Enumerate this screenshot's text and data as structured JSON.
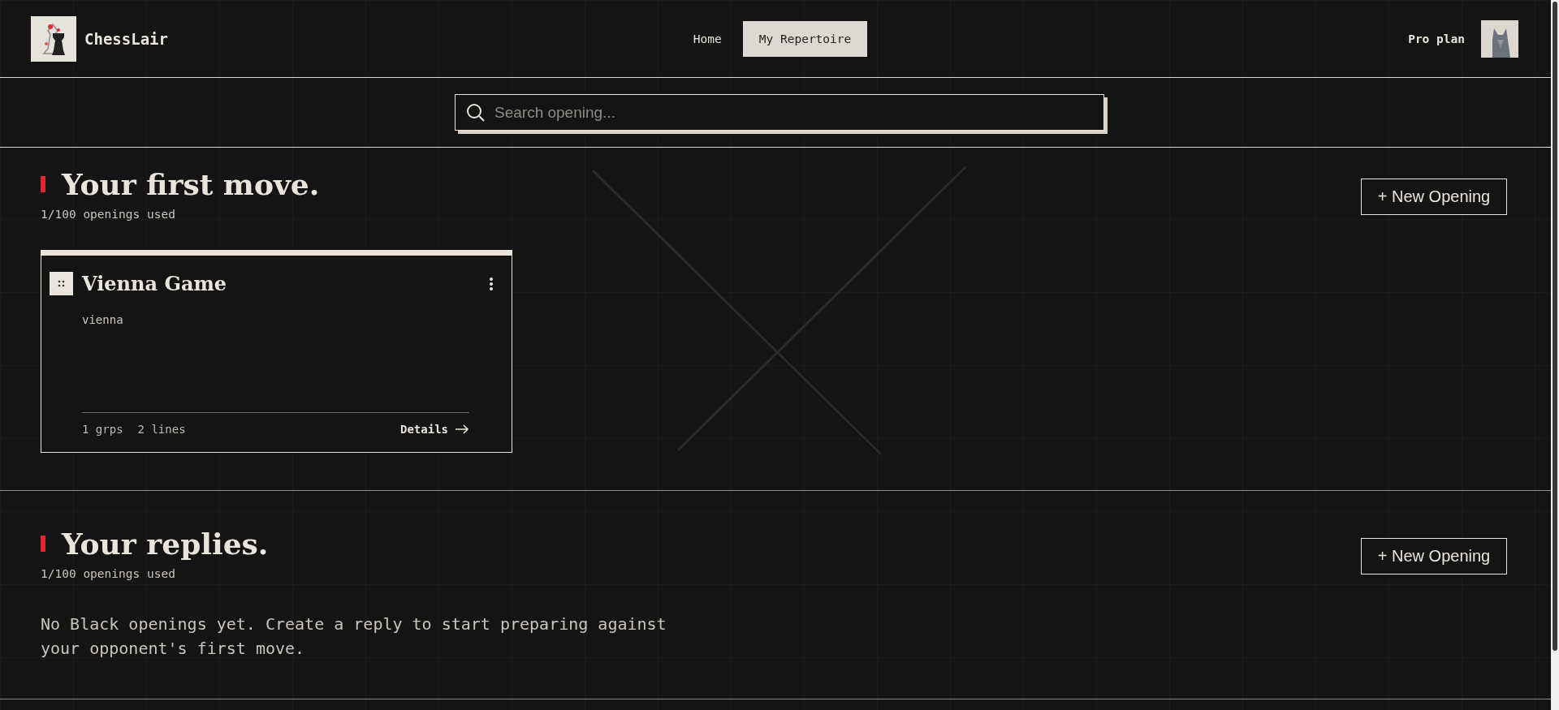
{
  "header": {
    "brand": "ChessLair",
    "nav": [
      {
        "label": "Home",
        "selected": false
      },
      {
        "label": "My Repertoire",
        "selected": true
      }
    ],
    "plan": "Pro plan"
  },
  "search": {
    "placeholder": "Search opening..."
  },
  "sections": [
    {
      "title": "Your first move.",
      "usage": "1/100 openings used",
      "button": "+ New Opening",
      "openings": [
        {
          "name": "Vienna Game",
          "tag": "vienna",
          "groups": "1 grps",
          "lines": "2 lines",
          "link": "Details"
        }
      ]
    },
    {
      "title": "Your replies.",
      "usage": "1/100 openings used",
      "button": "+ New Opening",
      "empty_message": "No Black openings yet. Create a reply to start preparing against your opponent's first move."
    }
  ]
}
